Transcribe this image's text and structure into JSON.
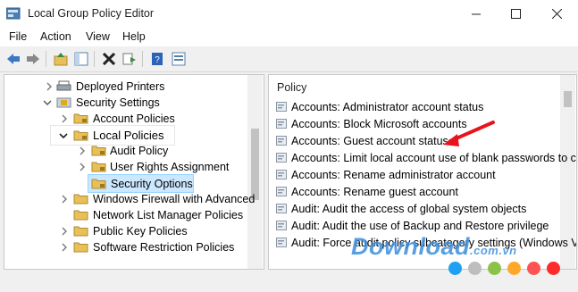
{
  "window": {
    "title": "Local Group Policy Editor"
  },
  "menu": [
    "File",
    "Action",
    "View",
    "Help"
  ],
  "tree": {
    "items": [
      {
        "label": "Deployed Printers"
      },
      {
        "label": "Security Settings"
      },
      {
        "label": "Account Policies"
      },
      {
        "label": "Local Policies"
      },
      {
        "label": "Audit Policy"
      },
      {
        "label": "User Rights Assignment"
      },
      {
        "label": "Security Options"
      },
      {
        "label": "Windows Firewall with Advanced"
      },
      {
        "label": "Network List Manager Policies"
      },
      {
        "label": "Public Key Policies"
      },
      {
        "label": "Software Restriction Policies"
      }
    ]
  },
  "policy": {
    "header": "Policy",
    "rows": [
      "Accounts: Administrator account status",
      "Accounts: Block Microsoft accounts",
      "Accounts: Guest account status",
      "Accounts: Limit local account use of blank passwords to c",
      "Accounts: Rename administrator account",
      "Accounts: Rename guest account",
      "Audit: Audit the access of global system objects",
      "Audit: Audit the use of Backup and Restore privilege",
      "Audit: Force audit policy subcategory settings (Windows V"
    ]
  },
  "watermark": {
    "text": "Download",
    "suffix": ".com.vn"
  },
  "colors": {
    "selection": "#cce8ff",
    "arrow": "#e8141b",
    "folder": "#e8c05a",
    "dots": [
      "#1ea1f2",
      "#bdbdbd",
      "#8bc34a",
      "#ffa726",
      "#ff5252"
    ]
  }
}
